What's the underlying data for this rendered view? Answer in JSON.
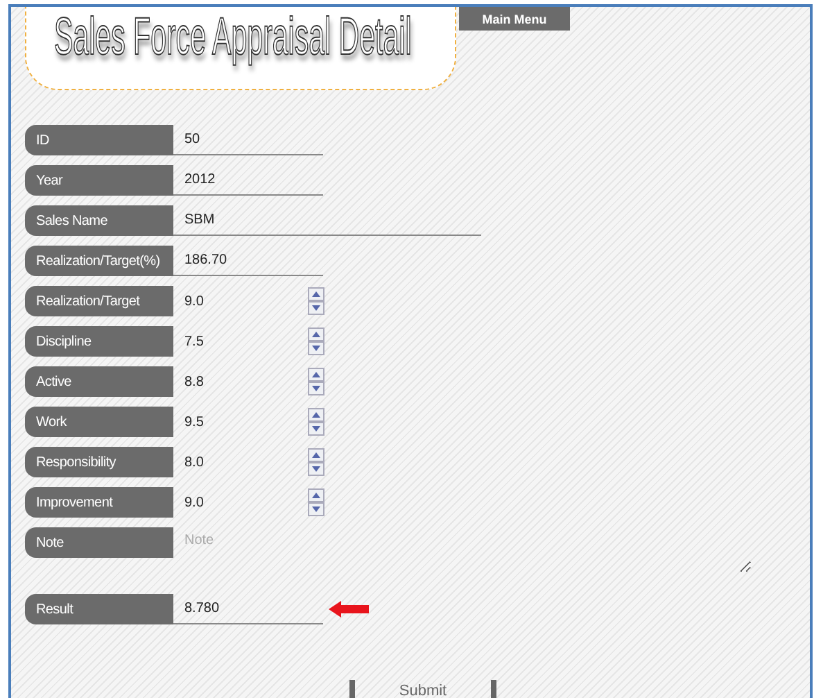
{
  "header": {
    "title": "Sales Force Appraisal Detail",
    "menu_button": "Main Menu"
  },
  "fields": [
    {
      "kind": "text",
      "label": "ID",
      "value": "50"
    },
    {
      "kind": "text",
      "label": "Year",
      "value": "2012"
    },
    {
      "kind": "longtext",
      "label": "Sales Name",
      "value": "SBM"
    },
    {
      "kind": "text",
      "label": "Realization/Target(%)",
      "value": "186.70"
    },
    {
      "kind": "spinner",
      "label": "Realization/Target",
      "value": "9.0"
    },
    {
      "kind": "spinner",
      "label": "Discipline",
      "value": "7.5"
    },
    {
      "kind": "spinner",
      "label": "Active",
      "value": "8.8"
    },
    {
      "kind": "spinner",
      "label": "Work",
      "value": "9.5"
    },
    {
      "kind": "spinner",
      "label": "Responsibility",
      "value": "8.0"
    },
    {
      "kind": "spinner",
      "label": "Improvement",
      "value": "9.0"
    },
    {
      "kind": "textarea",
      "label": "Note",
      "placeholder": "Note"
    }
  ],
  "result": {
    "label": "Result",
    "value": "8.780"
  },
  "submit": "Submit"
}
